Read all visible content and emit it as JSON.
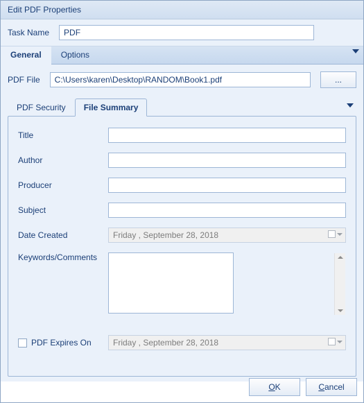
{
  "title": "Edit PDF Properties",
  "task": {
    "label": "Task Name",
    "value": "PDF"
  },
  "outerTabs": {
    "general": "General",
    "options": "Options"
  },
  "file": {
    "label": "PDF File",
    "value": "C:\\Users\\karen\\Desktop\\RANDOM\\Book1.pdf",
    "browse": "..."
  },
  "innerTabs": {
    "security": "PDF Security",
    "summary": "File Summary"
  },
  "form": {
    "title": {
      "label": "Title",
      "value": ""
    },
    "author": {
      "label": "Author",
      "value": ""
    },
    "producer": {
      "label": "Producer",
      "value": ""
    },
    "subject": {
      "label": "Subject",
      "value": ""
    },
    "dateCreated": {
      "label": "Date Created",
      "value": "Friday    , September 28, 2018"
    },
    "keywords": {
      "label": "Keywords/Comments",
      "value": ""
    },
    "expires": {
      "label": "PDF Expires On",
      "value": "Friday    , September 28, 2018",
      "checked": false
    }
  },
  "buttons": {
    "ok": "OK",
    "cancel": "Cancel"
  }
}
